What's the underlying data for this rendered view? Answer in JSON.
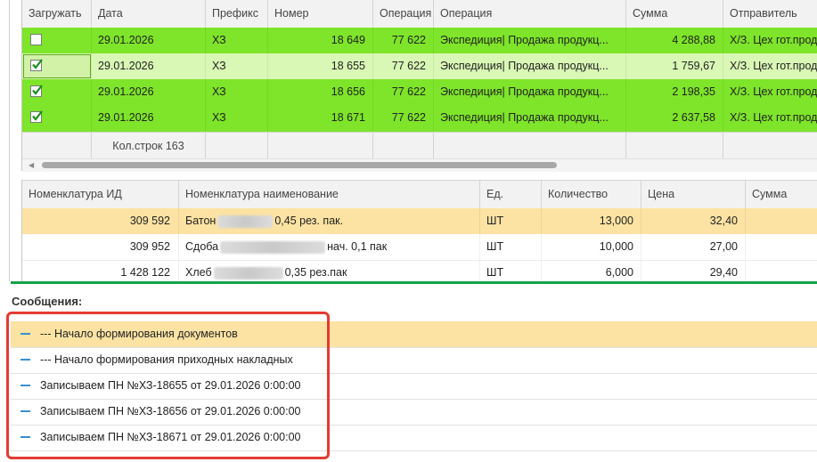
{
  "upper_table": {
    "columns": [
      "Загружать",
      "Дата",
      "Префикс",
      "Номер",
      "Операция",
      "Операция",
      "Сумма",
      "Отправитель"
    ],
    "rows": [
      {
        "checked": false,
        "date": "29.01.2026",
        "prefix": "ХЗ",
        "number": "18 649",
        "op_code": "77 622",
        "operation": "Экспедиция| Продажа продукц...",
        "sum": "4 288,88",
        "sender": "Х/З. Цех гот.прод"
      },
      {
        "checked": true,
        "date": "29.01.2026",
        "prefix": "ХЗ",
        "number": "18 655",
        "op_code": "77 622",
        "operation": "Экспедиция| Продажа продукц...",
        "sum": "1 759,67",
        "sender": "Х/З. Цех гот.прод"
      },
      {
        "checked": true,
        "date": "29.01.2026",
        "prefix": "ХЗ",
        "number": "18 656",
        "op_code": "77 622",
        "operation": "Экспедиция| Продажа продукц...",
        "sum": "2 198,35",
        "sender": "Х/З. Цех гот.прод"
      },
      {
        "checked": true,
        "date": "29.01.2026",
        "prefix": "ХЗ",
        "number": "18 671",
        "op_code": "77 622",
        "operation": "Экспедиция| Продажа продукц...",
        "sum": "2 637,58",
        "sender": "Х/З. Цех гот.прод"
      }
    ],
    "footer_count": "Кол.строк 163"
  },
  "lower_table": {
    "columns": [
      "Номенклатура ИД",
      "Номенклатура наименование",
      "Ед.",
      "Количество",
      "Цена",
      "Сумма"
    ],
    "rows": [
      {
        "id": "309 592",
        "name_start": "Батон",
        "name_end": "0,45 рез. пак.",
        "unit": "ШТ",
        "qty": "13,000",
        "price": "32,40"
      },
      {
        "id": "309 952",
        "name_start": "Сдоба",
        "name_end": "нач. 0,1 пак",
        "unit": "ШТ",
        "qty": "10,000",
        "price": "27,00"
      },
      {
        "id": "1 428 122",
        "name_start": "Хлеб",
        "name_end": "0,35 рез.пак",
        "unit": "ШТ",
        "qty": "6,000",
        "price": "29,40"
      }
    ]
  },
  "messages": {
    "title": "Сообщения:",
    "items": [
      "--- Начало формирования документов",
      "--- Начало формирования приходных накладных",
      "Записываем ПН №ХЗ-18655 от 29.01.2026 0:00:00",
      "Записываем ПН №ХЗ-18656 от 29.01.2026 0:00:00",
      "Записываем ПН №ХЗ-18671 от 29.01.2026 0:00:00"
    ]
  },
  "colors": {
    "row_green": "#7ee52a",
    "highlight": "#fce3a3",
    "annotation_red": "#e53b32",
    "separator_green": "#14a14b"
  }
}
